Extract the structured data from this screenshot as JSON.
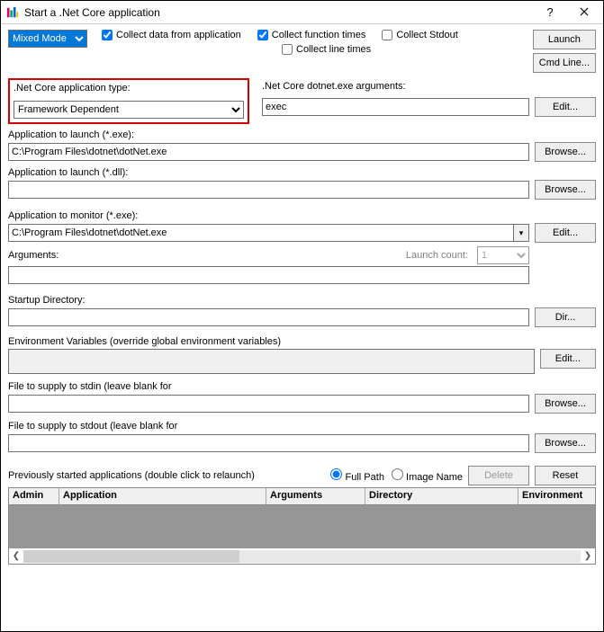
{
  "window": {
    "title": "Start a .Net Core application"
  },
  "toolbar": {
    "mode": "Mixed Mode",
    "mode_options": [
      "Mixed Mode"
    ],
    "collect_data": "Collect data from application",
    "collect_func": "Collect function times",
    "collect_stdout": "Collect Stdout",
    "collect_line": "Collect line times",
    "launch": "Launch",
    "cmdline": "Cmd Line..."
  },
  "apptype": {
    "label": ".Net Core application type:",
    "value": "Framework Dependent"
  },
  "dotnet_args": {
    "label": ".Net Core dotnet.exe arguments:",
    "value": "exec",
    "edit": "Edit..."
  },
  "app_exe": {
    "label": "Application to launch (*.exe):",
    "value": "C:\\Program Files\\dotnet\\dotNet.exe",
    "browse": "Browse..."
  },
  "app_dll": {
    "label": "Application to launch (*.dll):",
    "value": "",
    "browse": "Browse..."
  },
  "app_monitor": {
    "label": "Application to monitor (*.exe):",
    "value": "C:\\Program Files\\dotnet\\dotNet.exe",
    "edit": "Edit..."
  },
  "args": {
    "label": "Arguments:",
    "launch_count_label": "Launch count:",
    "launch_count": "1",
    "value": ""
  },
  "startup": {
    "label": "Startup Directory:",
    "value": "",
    "dir": "Dir..."
  },
  "env": {
    "label": "Environment Variables (override global environment variables)",
    "value": "",
    "edit": "Edit..."
  },
  "stdin": {
    "label": "File to supply to stdin (leave blank for",
    "value": "",
    "browse": "Browse..."
  },
  "stdout": {
    "label": "File to supply to stdout (leave blank for",
    "value": "",
    "browse": "Browse..."
  },
  "history": {
    "label": "Previously started applications (double click to relaunch)",
    "fullpath": "Full Path",
    "imagename": "Image Name",
    "delete": "Delete",
    "reset": "Reset",
    "cols": {
      "admin": "Admin",
      "application": "Application",
      "arguments": "Arguments",
      "directory": "Directory",
      "environment": "Environment"
    }
  }
}
